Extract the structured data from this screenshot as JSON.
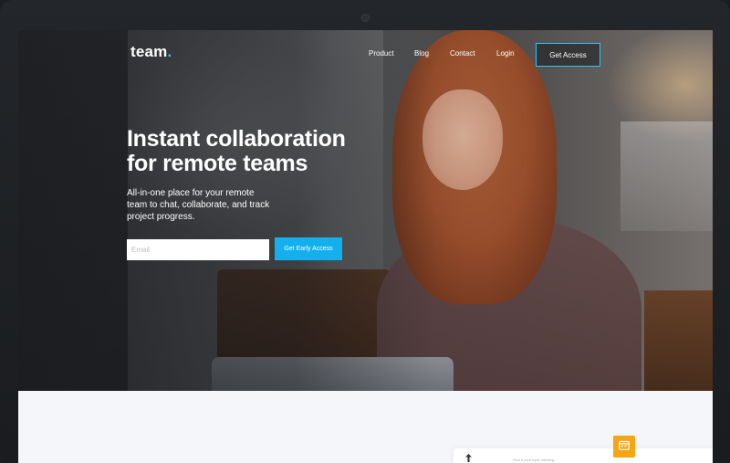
{
  "brand": {
    "name": "team",
    "dot": ".",
    "accent_color": "#2fc6f5"
  },
  "nav": {
    "items": [
      {
        "label": "Product"
      },
      {
        "label": "Blog"
      },
      {
        "label": "Contact"
      },
      {
        "label": "Login"
      }
    ],
    "cta_label": "Get Access"
  },
  "hero": {
    "headline_line1": "Instant collaboration",
    "headline_line2": "for remote teams",
    "subtext_line1": "All-in-one place for your remote",
    "subtext_line2": "team to chat, collaborate, and track",
    "subtext_line3": "project progress.",
    "email_placeholder": "Email",
    "cta_label": "Get Early Access"
  },
  "app_preview": {
    "upload_icon": "upload-icon",
    "search_placeholder": "Find a your topic meeting...",
    "calendar_icon": "calendar-icon"
  }
}
